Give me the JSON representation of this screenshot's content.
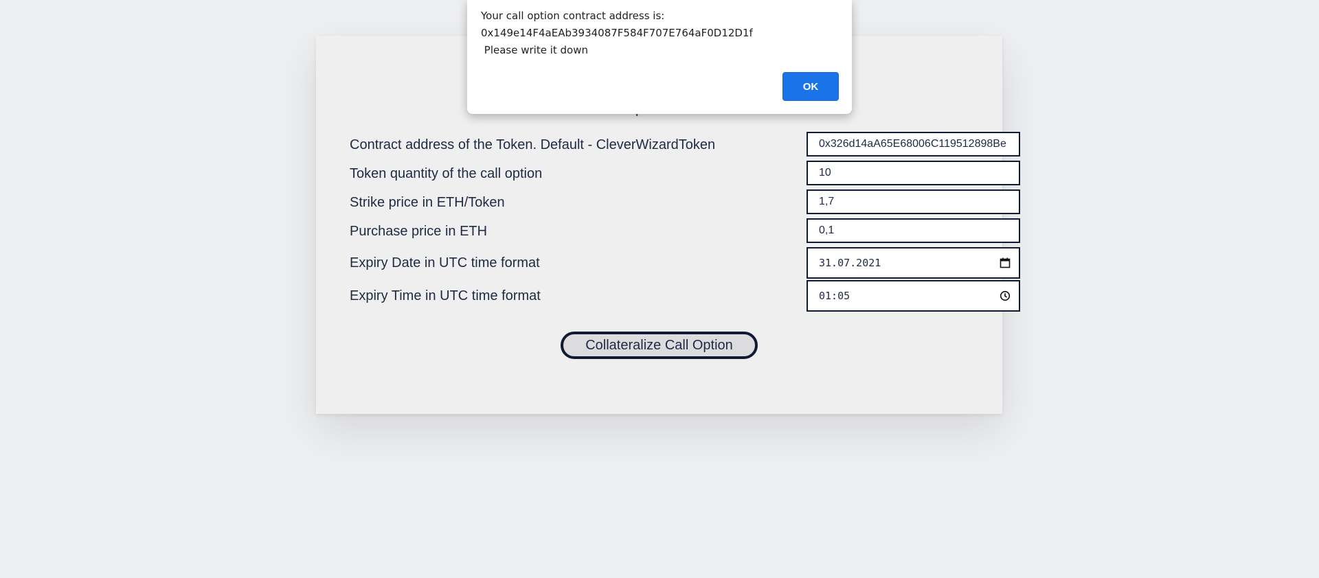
{
  "form": {
    "title": "Call Option Creation",
    "fields": [
      {
        "label": "Contract address of the Token. Default - CleverWizardToken",
        "value": "0x326d14aA65E68006C119512898Be"
      },
      {
        "label": "Token quantity of the call option",
        "value": "10"
      },
      {
        "label": "Strike price in ETH/Token",
        "value": "1,7"
      },
      {
        "label": "Purchase price in ETH",
        "value": "0,1"
      },
      {
        "label": "Expiry Date in UTC time format",
        "value": "31.07.2021",
        "icon": "calendar-icon"
      },
      {
        "label": "Expiry Time in UTC time format",
        "value": "01:05",
        "icon": "clock-icon"
      }
    ],
    "submit_label": "Collateralize Call Option"
  },
  "dialog": {
    "line1": "Your call option contract address is:",
    "line2": "0x149e14F4aEAb3934087F584F707E764aF0D12D1f",
    "line3": " Please write it down",
    "ok_label": "OK",
    "ok_color": "#1a73e8"
  }
}
